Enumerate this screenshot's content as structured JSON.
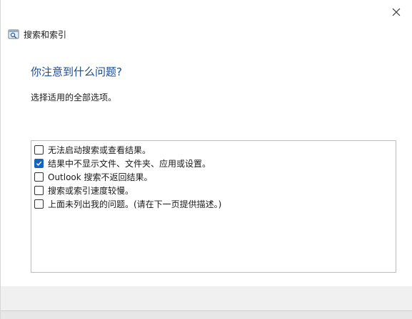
{
  "window": {
    "title": "搜索和索引",
    "close_icon": "close-icon",
    "app_icon": "search-index-icon"
  },
  "content": {
    "heading": "你注意到什么问题?",
    "instruction": "选择适用的全部选项。"
  },
  "options": [
    {
      "label": "无法启动搜索或查看结果。",
      "checked": false
    },
    {
      "label": "结果中不显示文件、文件夹、应用或设置。",
      "checked": true
    },
    {
      "label": "Outlook 搜索不返回结果。",
      "checked": false
    },
    {
      "label": "搜索或索引速度较慢。",
      "checked": false
    },
    {
      "label": "上面未列出我的问题。(请在下一页提供描述。)",
      "checked": false
    }
  ],
  "colors": {
    "heading": "#1e4a8a",
    "checkbox_checked": "#1565c0"
  }
}
